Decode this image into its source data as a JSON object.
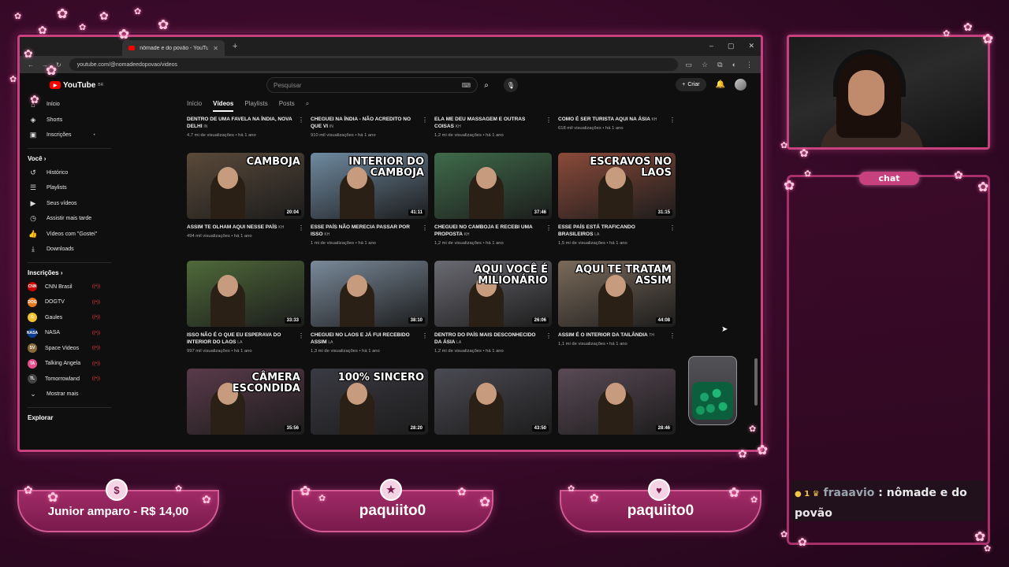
{
  "browser": {
    "tab_title": "nômade e do povão - YouTube",
    "new_tab": "+",
    "url": "youtube.com/@nomadeedopovao/videos",
    "window_controls": [
      "–",
      "▢",
      "✕"
    ]
  },
  "youtube": {
    "logo": "YouTube",
    "logo_region": "BR",
    "search_placeholder": "Pesquisar",
    "create_label": "Criar",
    "sidebar_main": [
      {
        "label": "Início",
        "icon": "home-icon",
        "glyph": "⌂"
      },
      {
        "label": "Shorts",
        "icon": "shorts-icon",
        "glyph": "◈"
      },
      {
        "label": "Inscrições",
        "icon": "subscriptions-icon",
        "glyph": "▣"
      }
    ],
    "you_heading": "Você",
    "sidebar_you": [
      {
        "label": "Histórico",
        "icon": "history-icon",
        "glyph": "↺"
      },
      {
        "label": "Playlists",
        "icon": "playlists-icon",
        "glyph": "☰"
      },
      {
        "label": "Seus vídeos",
        "icon": "your-videos-icon",
        "glyph": "▶"
      },
      {
        "label": "Assistir mais tarde",
        "icon": "watch-later-icon",
        "glyph": "◷"
      },
      {
        "label": "Vídeos com \"Gostei\"",
        "icon": "liked-icon",
        "glyph": "👍"
      },
      {
        "label": "Downloads",
        "icon": "downloads-icon",
        "glyph": "⤓"
      }
    ],
    "subs_heading": "Inscrições",
    "subscriptions": [
      {
        "label": "CNN Brasil",
        "color": "#cc0000",
        "abbr": "CNN"
      },
      {
        "label": "DOGTV",
        "color": "#e87722",
        "abbr": "DOG"
      },
      {
        "label": "Gaules",
        "color": "#f2c230",
        "abbr": "G"
      },
      {
        "label": "NASA",
        "color": "#0b3d91",
        "abbr": "NASA"
      },
      {
        "label": "Space Videos",
        "color": "#8a6a3a",
        "abbr": "SV"
      },
      {
        "label": "Talking Angela",
        "color": "#e64f8a",
        "abbr": "TA"
      },
      {
        "label": "Tomorrowland",
        "color": "#444444",
        "abbr": "TL"
      }
    ],
    "show_more": "Mostrar mais",
    "explore": "Explorar",
    "channel_tabs": [
      "Início",
      "Vídeos",
      "Playlists",
      "Posts"
    ],
    "active_tab": "Vídeos",
    "top_row": [
      {
        "title": "DENTRO DE UMA FAVELA NA ÍNDIA, NOVA DELHI",
        "tag": "IN",
        "meta": "4,7 mi de visualizações • há 1 ano"
      },
      {
        "title": "CHEGUEI NA ÍNDIA - NÃO ACREDITO NO QUE VI",
        "tag": "IN",
        "meta": "910 mil visualizações • há 1 ano"
      },
      {
        "title": "ELA ME DEU MASSAGEM E OUTRAS COISAS",
        "tag": "KH",
        "meta": "1,2 mi de visualizações • há 1 ano"
      },
      {
        "title": "COMO É SER TURISTA AQUI NA ÁSIA",
        "tag": "KH",
        "meta": "618 mil visualizações • há 1 ano"
      }
    ],
    "rows": [
      [
        {
          "overlay": "CAMBOJA",
          "duration": "20:04",
          "title": "ASSIM TE OLHAM AQUI NESSE PAÍS",
          "tag": "KH",
          "meta": "494 mil visualizações • há 1 ano",
          "bg": "#5a4a3a"
        },
        {
          "overlay": "INTERIOR DO CAMBOJA",
          "duration": "41:11",
          "title": "ESSE PAÍS NÃO MERECIA PASSAR POR ISSO",
          "tag": "KH",
          "meta": "1 mi de visualizações • há 1 ano",
          "bg": "#6f8aa0"
        },
        {
          "overlay": "",
          "duration": "37:46",
          "title": "CHEGUEI NO CAMBOJA E RECEBI UMA PROPOSTA",
          "tag": "KH",
          "meta": "1,2 mi de visualizações • há 1 ano",
          "bg": "#3f6b4a"
        },
        {
          "overlay": "ESCRAVOS NO LAOS",
          "duration": "31:15",
          "title": "ESSE PAÍS ESTÁ TRAFICANDO BRASILEIROS",
          "tag": "LA",
          "meta": "1,5 mi de visualizações • há 1 ano",
          "bg": "#8a4a3a"
        }
      ],
      [
        {
          "overlay": "",
          "duration": "33:33",
          "title": "ISSO NÃO É O QUE EU ESPERAVA DO INTERIOR DO LAOS",
          "tag": "LA",
          "meta": "997 mil visualizações • há 1 ano",
          "bg": "#4f6a3a"
        },
        {
          "overlay": "",
          "duration": "38:10",
          "title": "CHEGUEI NO LAOS E JÁ FUI RECEBIDO ASSIM",
          "tag": "LA",
          "meta": "1,3 mi de visualizações • há 1 ano",
          "bg": "#7a8a9a"
        },
        {
          "overlay": "AQUI VOCÊ É MILIONÁRIO",
          "duration": "26:06",
          "title": "DENTRO DO PAÍS MAIS DESCONHECIDO DA ÁSIA",
          "tag": "LA",
          "meta": "1,2 mi de visualizações • há 1 ano",
          "bg": "#6a6a72"
        },
        {
          "overlay": "AQUI TE TRATAM ASSIM",
          "duration": "44:08",
          "title": "ASSIM É O INTERIOR DA TAILÂNDIA",
          "tag": "TH",
          "meta": "1,1 mi de visualizações • há 1 ano",
          "bg": "#7a6a5a"
        }
      ],
      [
        {
          "overlay": "CÂMERA ESCONDIDA",
          "duration": "35:56",
          "title": "",
          "tag": "",
          "meta": "",
          "bg": "#5a3a4a"
        },
        {
          "overlay": "100% SINCERO",
          "duration": "28:20",
          "title": "",
          "tag": "",
          "meta": "",
          "bg": "#3a3a42"
        },
        {
          "overlay": "",
          "duration": "43:50",
          "title": "",
          "tag": "",
          "meta": "",
          "bg": "#4a4a52"
        },
        {
          "overlay": "",
          "duration": "28:46",
          "title": "",
          "tag": "",
          "meta": "",
          "bg": "#5a4a55"
        }
      ]
    ]
  },
  "overlay": {
    "chat_label": "chat",
    "chat_user": "fraaavio",
    "chat_sep": ":",
    "chat_text": "nômade e do povão",
    "chat_badge": "1",
    "donation": "Junior amparo - R$ 14,00",
    "follower": "paquiito0",
    "subscriber": "paquiito0",
    "badge_1": "$",
    "badge_2": "★",
    "badge_3": "♥"
  },
  "colors": {
    "accent_pink": "#c8417f",
    "youtube_red": "#ff0000",
    "bg_dark": "#0f0f0f"
  }
}
